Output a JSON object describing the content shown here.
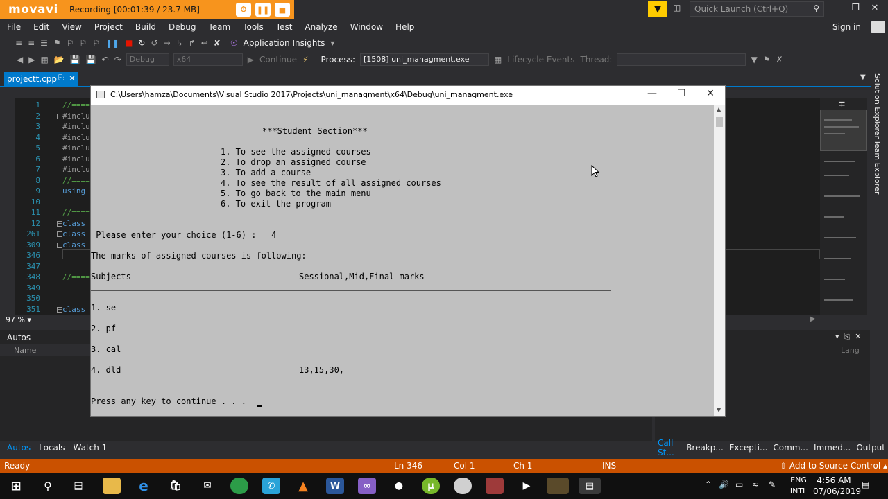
{
  "recorder": {
    "logo": "movavi",
    "status": "Recording  [00:01:39 / 23.7 MB]"
  },
  "vs": {
    "quick_launch_placeholder": "Quick Launch (Ctrl+Q)",
    "menu": [
      "File",
      "Edit",
      "View",
      "Project",
      "Build",
      "Debug",
      "Team",
      "Tools",
      "Test",
      "Analyze",
      "Window",
      "Help"
    ],
    "sign_in": "Sign in",
    "toolbar1": {
      "app_insights": "Application Insights"
    },
    "toolbar2": {
      "config": "Debug",
      "platform": "x64",
      "continue": "Continue",
      "process_label": "Process:",
      "process_value": "[1508] uni_managment.exe",
      "lifecycle": "Lifecycle Events",
      "thread": "Thread:"
    },
    "tab": {
      "name": "projectt.cpp"
    },
    "editor": {
      "lines": [
        {
          "num": "1",
          "code": "//====",
          "color": "#57a64a"
        },
        {
          "num": "2",
          "code": "#inclu",
          "color": "#9b9b9b"
        },
        {
          "num": "3",
          "code": "#inclu",
          "color": "#9b9b9b"
        },
        {
          "num": "4",
          "code": "#inclu",
          "color": "#9b9b9b"
        },
        {
          "num": "5",
          "code": "#inclu",
          "color": "#9b9b9b"
        },
        {
          "num": "6",
          "code": "#inclu",
          "color": "#9b9b9b"
        },
        {
          "num": "7",
          "code": "#inclu",
          "color": "#9b9b9b"
        },
        {
          "num": "8",
          "code": "//====",
          "color": "#57a64a"
        },
        {
          "num": "9",
          "code": "using",
          "color": "#569cd6"
        },
        {
          "num": "10",
          "code": "",
          "color": "#dcdcdc"
        },
        {
          "num": "11",
          "code": "//====",
          "color": "#57a64a"
        },
        {
          "num": "12",
          "code": "class",
          "color": "#569cd6"
        },
        {
          "num": "261",
          "code": "class",
          "color": "#569cd6"
        },
        {
          "num": "309",
          "code": "class",
          "color": "#569cd6"
        },
        {
          "num": "346",
          "code": "",
          "color": "#dcdcdc"
        },
        {
          "num": "347",
          "code": "",
          "color": "#dcdcdc"
        },
        {
          "num": "348",
          "code": "//====",
          "color": "#57a64a"
        },
        {
          "num": "349",
          "code": "",
          "color": "#dcdcdc"
        },
        {
          "num": "350",
          "code": "",
          "color": "#dcdcdc"
        },
        {
          "num": "351",
          "code": "class",
          "color": "#569cd6"
        }
      ]
    },
    "zoom": "97 %",
    "side_tabs": [
      "Solution Explorer",
      "Team Explorer"
    ],
    "autos": {
      "title": "Autos",
      "col_name": "Name",
      "col_lang": "Lang"
    },
    "bottom_tabs_left": [
      "Autos",
      "Locals",
      "Watch 1"
    ],
    "bottom_tabs_right": [
      "Call St...",
      "Breakp...",
      "Excepti...",
      "Comm...",
      "Immed...",
      "Output"
    ],
    "status": {
      "ready": "Ready",
      "ln": "Ln 346",
      "col": "Col 1",
      "ch": "Ch 1",
      "ins": "INS",
      "source_control": "Add to Source Control"
    }
  },
  "console": {
    "title": "C:\\Users\\hamza\\Documents\\Visual Studio 2017\\Projects\\uni_managment\\x64\\Debug\\uni_managment.exe",
    "heading": "***Student Section***",
    "menu": [
      "1. To see the assigned courses",
      "2. To drop an assigned course",
      "3. To add a course",
      "4. To see the result of all assigned courses",
      "5. To go back to the main menu",
      "6. To exit the program"
    ],
    "prompt": " Please enter your choice (1-6) :   4",
    "marks_intro": "The marks of assigned courses is following:-",
    "col_subjects": "Subjects",
    "col_marks": "Sessional,Mid,Final marks",
    "rows": [
      {
        "subject": "1. se",
        "marks": ""
      },
      {
        "subject": "2. pf",
        "marks": ""
      },
      {
        "subject": "3. cal",
        "marks": ""
      },
      {
        "subject": "4. dld",
        "marks": "13,15,30,"
      }
    ],
    "continue": "Press any key to continue . . ."
  },
  "taskbar": {
    "lang": "ENG",
    "lang2": "INTL",
    "time": "4:56 AM",
    "date": "07/06/2019"
  }
}
